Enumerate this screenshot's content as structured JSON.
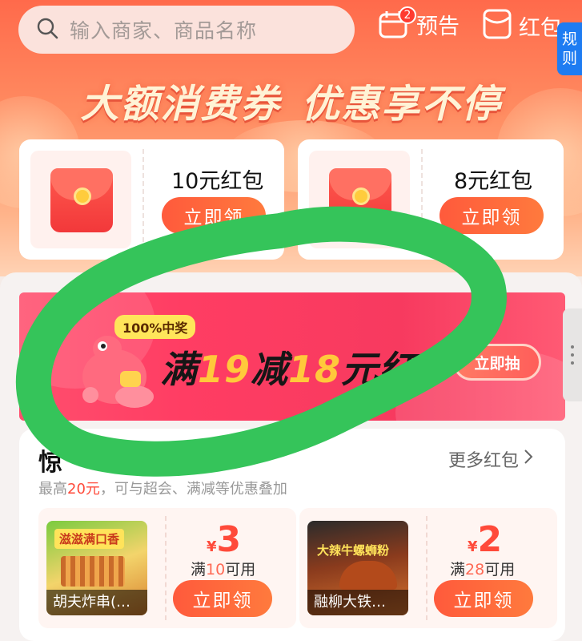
{
  "search": {
    "placeholder": "输入商家、商品名称",
    "icon": "search-icon"
  },
  "header": {
    "preview": {
      "label": "预告",
      "badge": "2",
      "icon": "calendar-icon"
    },
    "red_packet": {
      "label": "红包",
      "icon": "red-packet-icon"
    },
    "rules": [
      "规",
      "则"
    ]
  },
  "banner_title": {
    "left": "大额消费券",
    "right": "优惠享不停"
  },
  "coupons": [
    {
      "amount": "10元红包",
      "button": "立即领"
    },
    {
      "amount": "8元红包",
      "button": "立即领"
    }
  ],
  "promo": {
    "tag": "100%中奖",
    "pre": "满",
    "min": "19",
    "mid": "减",
    "off": "18",
    "post": "元红",
    "button": "立即抽"
  },
  "section": {
    "title": "惊",
    "more": "更多红包",
    "subtitle_pre": "最高",
    "subtitle_amount": "20元",
    "subtitle_post": "，可与超会、满减等优惠叠加"
  },
  "shops": [
    {
      "name": "胡夫炸串(…",
      "price_symbol": "¥",
      "price": "3",
      "cond_pre": "满",
      "cond_num": "10",
      "cond_post": "可用",
      "button": "立即领",
      "image_text": "滋滋满口香"
    },
    {
      "name": "融柳大铁…",
      "price_symbol": "¥",
      "price": "2",
      "cond_pre": "满",
      "cond_num": "28",
      "cond_post": "可用",
      "button": "立即领",
      "image_text": "大辣牛螺蛳粉"
    }
  ],
  "colors": {
    "accent": "#ff5a3c",
    "price_red": "#ff4a3a",
    "banner_pink": "#ff3d63",
    "marker_green": "#35c45a",
    "rules_blue": "#1e7cf2"
  }
}
